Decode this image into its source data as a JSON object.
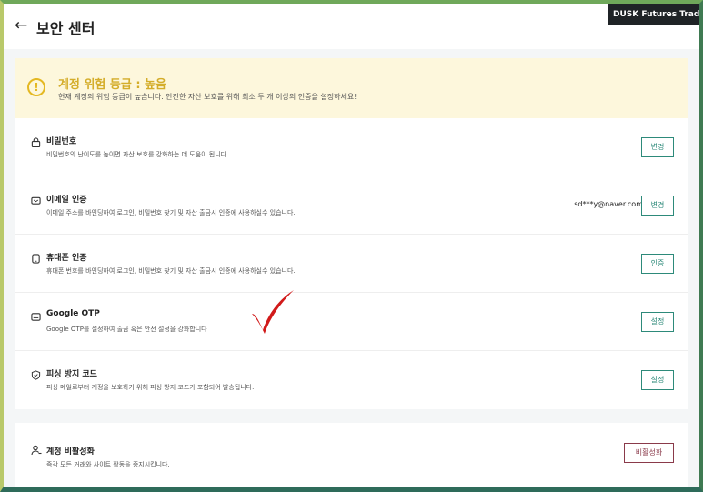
{
  "header": {
    "back_icon": "←",
    "title": "보안 센터",
    "badge": "DUSK Futures Trading E"
  },
  "alert": {
    "icon": "!",
    "title": "계정 위험 등급 : 높음",
    "desc": "현재 계정의 위험 등급이 높습니다. 안전한 자산 보호를 위해 최소 두 개 이상의 인증을 설정하세요!",
    "color": "#d4ad2a"
  },
  "security_items": [
    {
      "icon": "lock-icon",
      "title": "비밀번호",
      "desc": "비밀번호의 난이도를 높이면 자산 보호를 강화하는 데 도움이 됩니다",
      "value": "",
      "button": "변경"
    },
    {
      "icon": "mail-icon",
      "title": "이메일 인증",
      "desc": "이메일 주소를 바인딩하여 로그인, 비밀번호 찾기 및 자산 출금시 인증에 사용하실수 있습니다.",
      "value": "sd***y@naver.com",
      "button": "변경"
    },
    {
      "icon": "phone-icon",
      "title": "휴대폰 인증",
      "desc": "휴대폰 번호를 바인딩하여 로그인, 비밀번호 찾기 및 자산 출금시 인증에 사용하실수 있습니다.",
      "value": "",
      "button": "인증"
    },
    {
      "icon": "otp-icon",
      "title": "Google OTP",
      "desc": "Google OTP를 설정하여 출금 혹은 안전 설정을 강화합니다",
      "value": "",
      "button": "설정"
    },
    {
      "icon": "shield-icon",
      "title": "피싱 방지 코드",
      "desc": "피싱 메일로부터 계정을 보호하기 위해 피싱 방지 코드가 포함되어 발송됩니다.",
      "value": "",
      "button": "설정"
    }
  ],
  "deactivate": {
    "icon": "user-remove-icon",
    "title": "계정 비활성화",
    "desc": "즉각 모든 거래와 사이트 활동을 중지시킵니다.",
    "button": "비활성화"
  },
  "annotation": {
    "icon": "red-checkmark",
    "color": "#d11a1a"
  },
  "colors": {
    "accent": "#2d8a7a",
    "danger": "#8a3a4a",
    "warning": "#e4b822"
  }
}
